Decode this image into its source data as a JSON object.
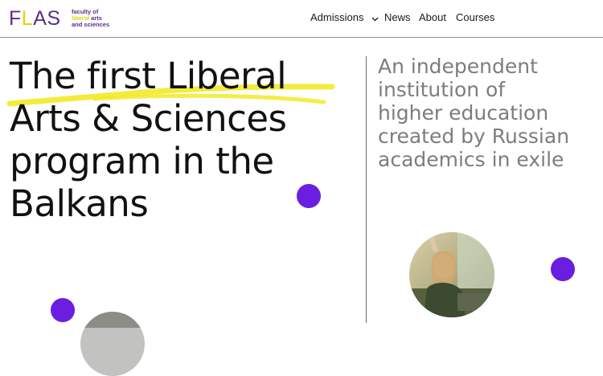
{
  "logo": {
    "wordmark_pre": "F",
    "wordmark_accent": "L",
    "wordmark_post": "AS",
    "tagline_line1": "faculty of",
    "tagline_line2_accent": "liberal",
    "tagline_line2_rest": " arts",
    "tagline_line3": "and sciences"
  },
  "nav": {
    "admissions": "Admissions",
    "news": "News",
    "about": "About",
    "courses": "Courses"
  },
  "hero": {
    "headline_lines": [
      "The first Liberal",
      "Arts & Sciences",
      "program in the",
      "Balkans"
    ],
    "subhead_lines": [
      "An independent",
      "institution of",
      "higher education",
      "created by Russian",
      "academics in exile"
    ]
  },
  "colors": {
    "brand_purple": "#5a2f8c",
    "accent_yellow": "#f2ea2a",
    "dot_violet": "#6a1ee0",
    "subhead_gray": "#7d7d7d"
  }
}
